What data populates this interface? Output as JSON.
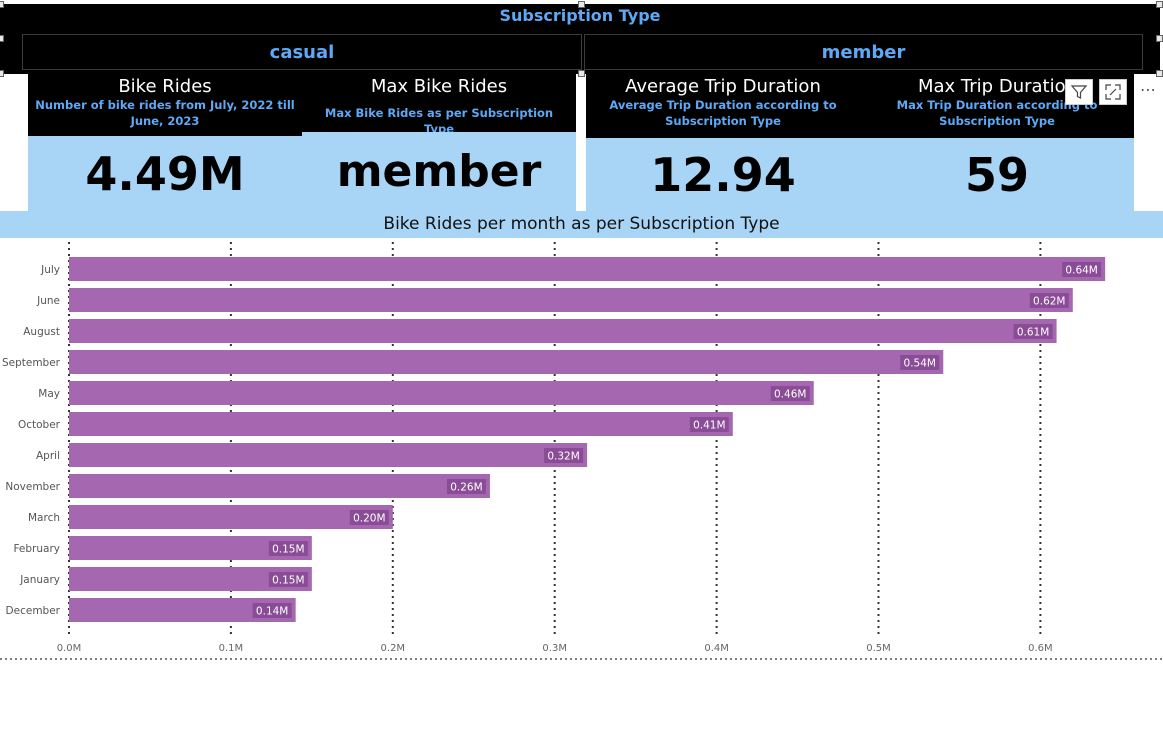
{
  "slicer": {
    "title": "Subscription Type",
    "options": [
      "casual",
      "member"
    ]
  },
  "kpis": [
    {
      "title": "Bike Rides",
      "subtitle": "Number of bike rides from July, 2022 till June, 2023",
      "value": "4.49M"
    },
    {
      "title": "Max Bike Rides",
      "subtitle": "Max Bike Rides as per Subscription Type",
      "value": "member"
    },
    {
      "title": "Average Trip Duration",
      "subtitle": "Average Trip Duration according to Subscription Type",
      "value": "12.94"
    },
    {
      "title": "Max Trip Duration",
      "subtitle": "Max Trip Duration according to Subscription Type",
      "value": "59"
    }
  ],
  "chart_data": {
    "type": "bar",
    "orientation": "horizontal",
    "title": "Bike Rides per month as per Subscription Type",
    "categories": [
      "July",
      "June",
      "August",
      "September",
      "May",
      "October",
      "April",
      "November",
      "March",
      "February",
      "January",
      "December"
    ],
    "values": [
      0.64,
      0.62,
      0.61,
      0.54,
      0.46,
      0.41,
      0.32,
      0.26,
      0.2,
      0.15,
      0.15,
      0.14
    ],
    "data_labels": [
      "0.64M",
      "0.62M",
      "0.61M",
      "0.54M",
      "0.46M",
      "0.41M",
      "0.32M",
      "0.26M",
      "0.20M",
      "0.15M",
      "0.15M",
      "0.14M"
    ],
    "x_ticks": [
      "0.0M",
      "0.1M",
      "0.2M",
      "0.3M",
      "0.4M",
      "0.5M",
      "0.6M"
    ],
    "xlim": [
      0,
      0.6
    ],
    "bar_color": "#a567b0",
    "grid": true
  },
  "colors": {
    "slicer_bg": "#000000",
    "accent_blue": "#5ea8f5",
    "card_fill": "#a8d4f5",
    "bar": "#a567b0"
  },
  "icons": [
    "filter-icon",
    "focus-mode-icon",
    "more-options-icon"
  ]
}
